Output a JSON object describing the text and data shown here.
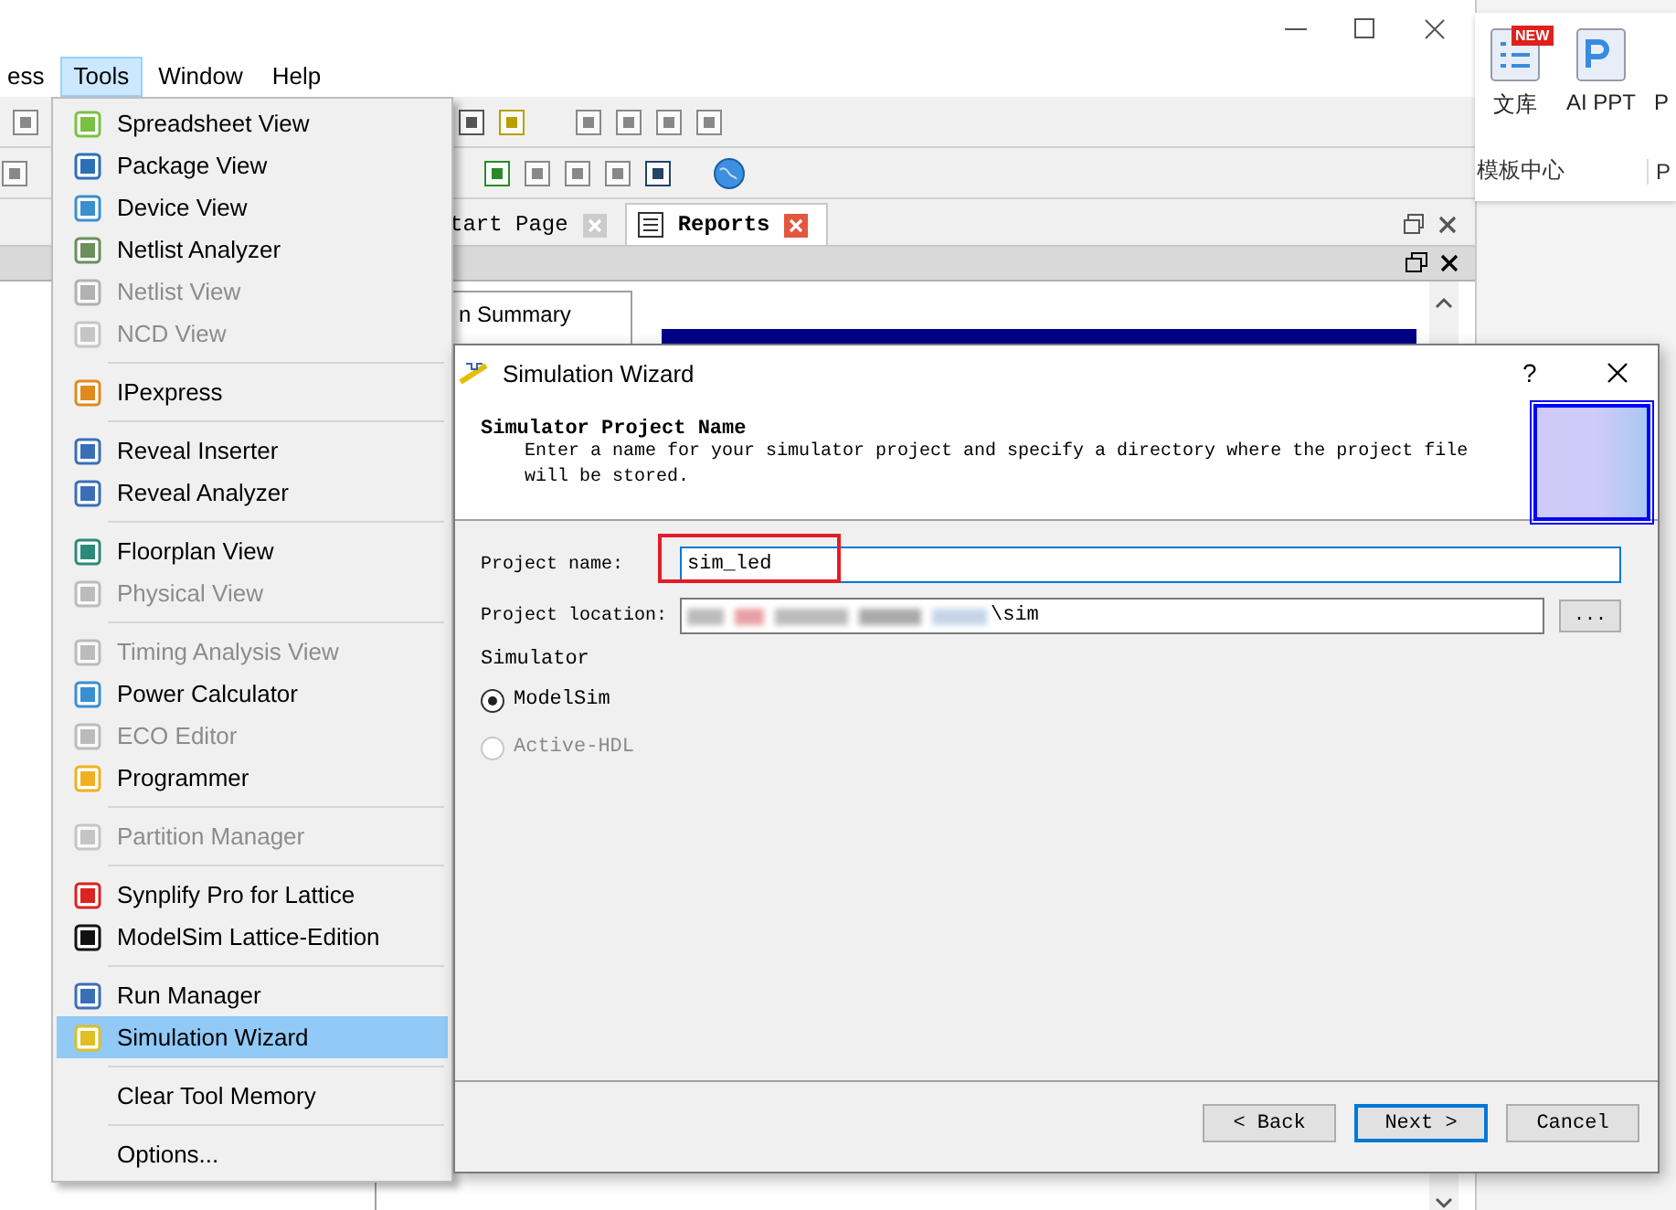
{
  "app": {
    "menubar": [
      {
        "label": "ess",
        "selected": false
      },
      {
        "label": "Tools",
        "selected": true
      },
      {
        "label": "Window",
        "selected": false
      },
      {
        "label": "Help",
        "selected": false
      }
    ],
    "tabs": [
      {
        "label": "tart Page",
        "selected": false
      },
      {
        "label": "Reports",
        "selected": true
      }
    ],
    "summary_label": "n Summary"
  },
  "ribbon": {
    "items": [
      {
        "label": "文库",
        "badge": "NEW"
      },
      {
        "label": "AI PPT"
      },
      {
        "label": "P"
      }
    ],
    "groups": [
      "模板中心",
      "P"
    ]
  },
  "tools_menu": {
    "groups": [
      [
        {
          "label": "Spreadsheet View",
          "disabled": false,
          "selected": false
        },
        {
          "label": "Package View",
          "disabled": false,
          "selected": false
        },
        {
          "label": "Device View",
          "disabled": false,
          "selected": false
        },
        {
          "label": "Netlist Analyzer",
          "disabled": false,
          "selected": false
        },
        {
          "label": "Netlist View",
          "disabled": true,
          "selected": false
        },
        {
          "label": "NCD View",
          "disabled": true,
          "selected": false
        }
      ],
      [
        {
          "label": "IPexpress",
          "disabled": false,
          "selected": false
        }
      ],
      [
        {
          "label": "Reveal Inserter",
          "disabled": false,
          "selected": false
        },
        {
          "label": "Reveal Analyzer",
          "disabled": false,
          "selected": false
        }
      ],
      [
        {
          "label": "Floorplan View",
          "disabled": false,
          "selected": false
        },
        {
          "label": "Physical View",
          "disabled": true,
          "selected": false
        }
      ],
      [
        {
          "label": "Timing Analysis View",
          "disabled": true,
          "selected": false
        },
        {
          "label": "Power Calculator",
          "disabled": false,
          "selected": false
        },
        {
          "label": "ECO Editor",
          "disabled": true,
          "selected": false
        },
        {
          "label": "Programmer",
          "disabled": false,
          "selected": false
        }
      ],
      [
        {
          "label": "Partition Manager",
          "disabled": true,
          "selected": false
        }
      ],
      [
        {
          "label": "Synplify Pro for Lattice",
          "disabled": false,
          "selected": false
        },
        {
          "label": "ModelSim Lattice-Edition",
          "disabled": false,
          "selected": false
        }
      ],
      [
        {
          "label": "Run Manager",
          "disabled": false,
          "selected": false
        },
        {
          "label": "Simulation Wizard",
          "disabled": false,
          "selected": true
        }
      ],
      [
        {
          "label": "Clear Tool Memory",
          "disabled": false,
          "selected": false
        }
      ],
      [
        {
          "label": "Options...",
          "disabled": false,
          "selected": false
        }
      ]
    ]
  },
  "dialog": {
    "title": "Simulation Wizard",
    "help": "?",
    "heading": "Simulator Project Name",
    "description": "Enter a name for your simulator project and specify a directory where the project file will be stored.",
    "fields": [
      {
        "label": "Project name:",
        "value": "sim_led",
        "focused": true,
        "highlighted": true,
        "blurred": false
      },
      {
        "label": "Project location:",
        "value": "\\sim",
        "focused": false,
        "highlighted": false,
        "blurred": true,
        "browse": "..."
      }
    ],
    "simulator": {
      "label": "Simulator",
      "options": [
        {
          "label": "ModelSim",
          "selected": true,
          "disabled": false
        },
        {
          "label": "Active-HDL",
          "selected": false,
          "disabled": true
        }
      ]
    },
    "buttons": [
      {
        "label": "< Back",
        "default": false
      },
      {
        "label": "Next >",
        "default": true
      },
      {
        "label": "Cancel",
        "default": false
      }
    ]
  }
}
